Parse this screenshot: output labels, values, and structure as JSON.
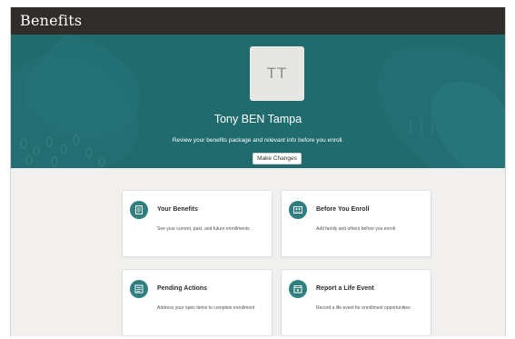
{
  "header": {
    "title": "Benefits"
  },
  "hero": {
    "avatar_initials": "TT",
    "name": "Tony BEN Tampa",
    "subtitle": "Review your benefits package and relevant info before you enroll.",
    "make_changes_label": "Make Changes"
  },
  "cards": [
    {
      "title": "Your Benefits",
      "description": "See your current, past, and future enrollments",
      "icon": "document-icon"
    },
    {
      "title": "Before You Enroll",
      "description": "Add family and others before you enroll",
      "icon": "family-icon"
    },
    {
      "title": "Pending Actions",
      "description": "Address your open items to complete enrollment",
      "icon": "checklist-icon"
    },
    {
      "title": "Report a Life Event",
      "description": "Record a life event for enrollment opportunities",
      "icon": "calendar-star-icon"
    }
  ],
  "colors": {
    "header_bg": "#312d2a",
    "hero_bg": "#1f6b6e",
    "icon_bg": "#2f7f80",
    "content_bg": "#f1f0ee"
  }
}
